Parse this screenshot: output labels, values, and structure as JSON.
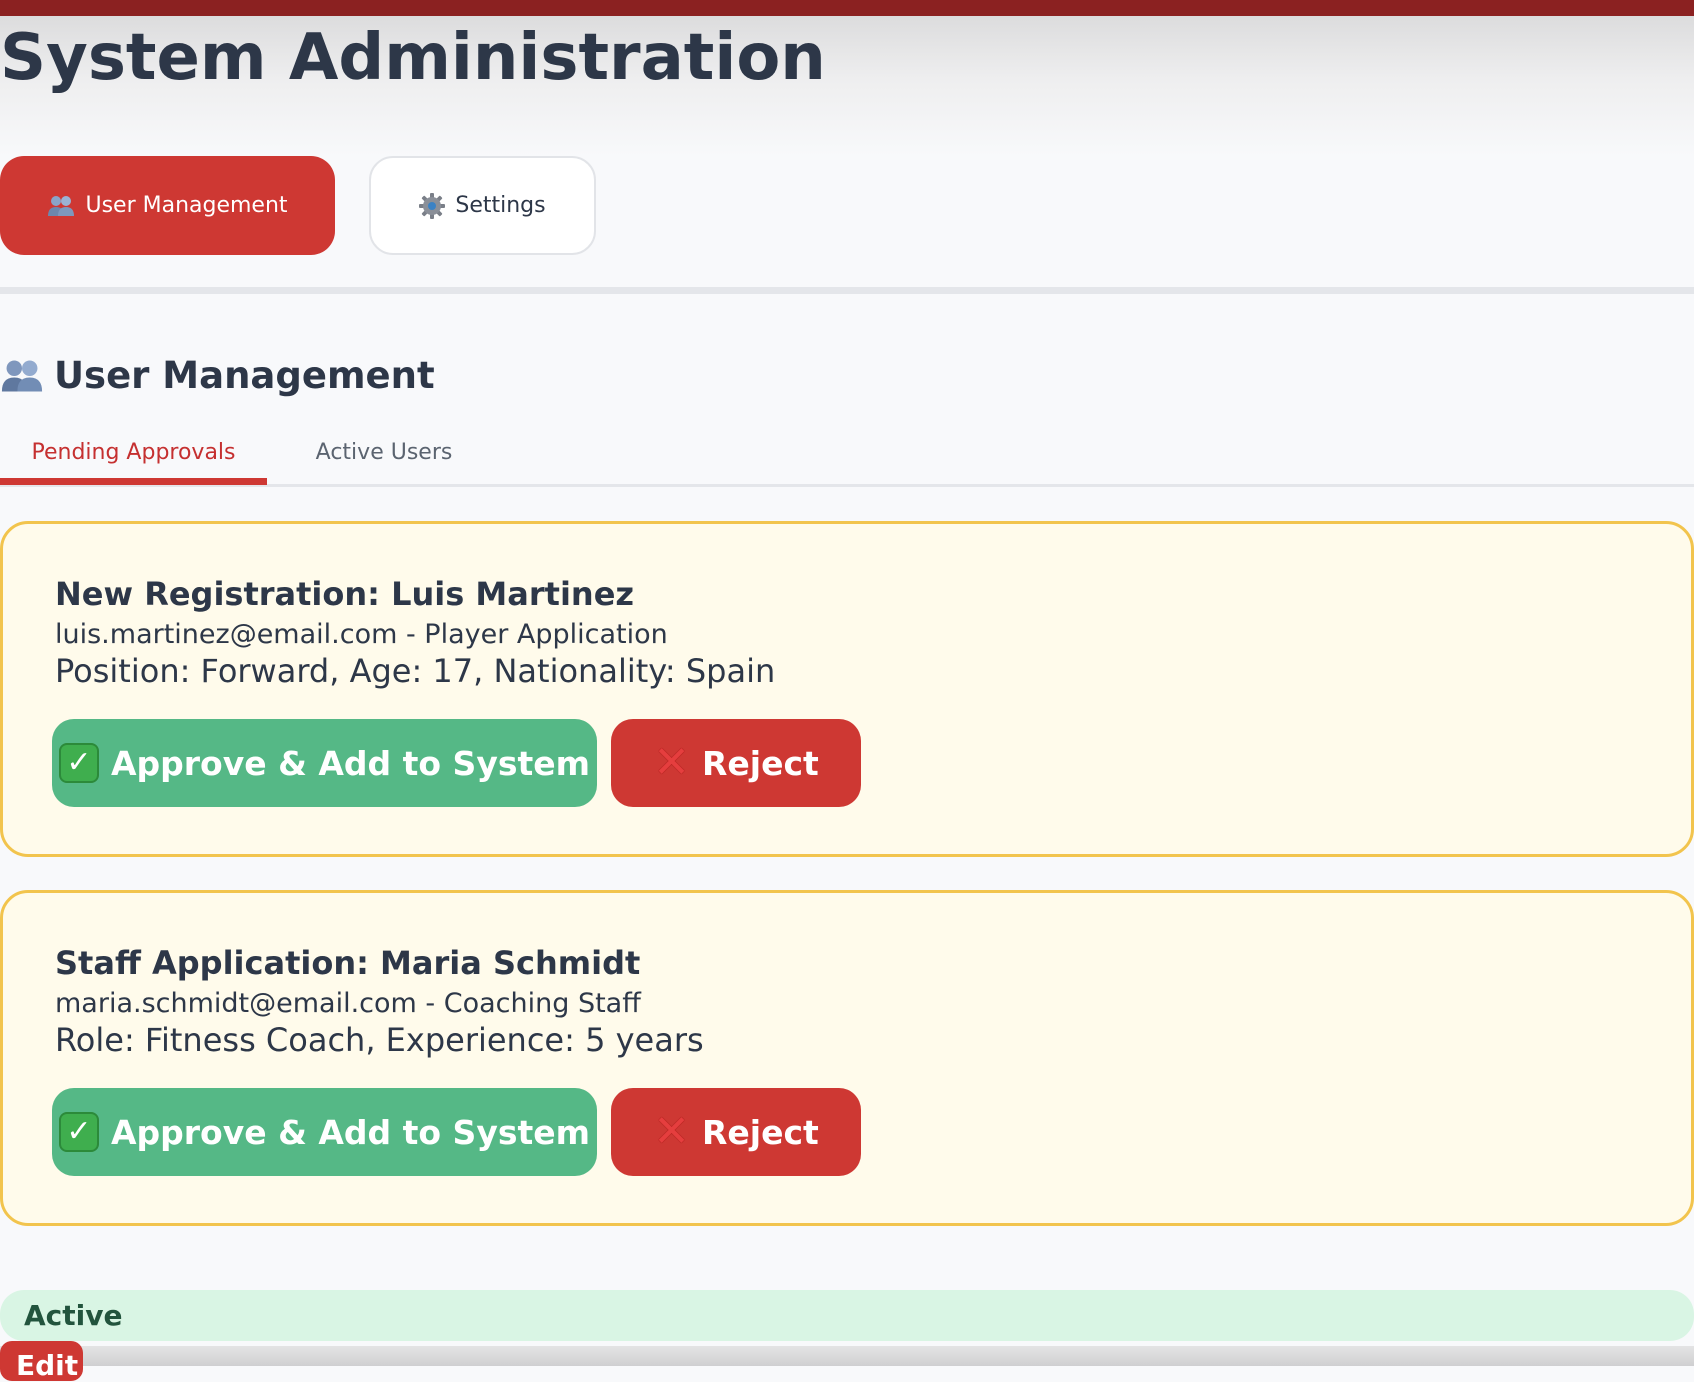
{
  "header": {
    "title": "System Administration"
  },
  "nav": {
    "user_management_label": "User Management",
    "user_management_icon": "users-icon",
    "settings_label": "Settings",
    "settings_icon": "gear-icon"
  },
  "section": {
    "title": "User Management",
    "icon": "users-icon",
    "tabs": [
      {
        "label": "Pending Approvals",
        "active": true
      },
      {
        "label": "Active Users",
        "active": false
      }
    ]
  },
  "pending": [
    {
      "title": "New Registration: Luis Martinez",
      "email_line": "luis.martinez@email.com - Player Application",
      "details": "Position: Forward, Age: 17, Nationality: Spain",
      "approve_label": "Approve & Add to System",
      "reject_label": "Reject"
    },
    {
      "title": "Staff Application: Maria Schmidt",
      "email_line": "maria.schmidt@email.com - Coaching Staff",
      "details": "Role: Fitness Coach, Experience: 5 years",
      "approve_label": "Approve & Add to System",
      "reject_label": "Reject"
    }
  ],
  "active_users": {
    "status_label": "Active",
    "edit_label": "Edit"
  },
  "colors": {
    "accent": "#ce3833",
    "approve": "#55b886",
    "card_bg": "#fffbeb",
    "card_border": "#f2c44d",
    "active_bg": "#d9f5e4",
    "text": "#2d3748"
  }
}
